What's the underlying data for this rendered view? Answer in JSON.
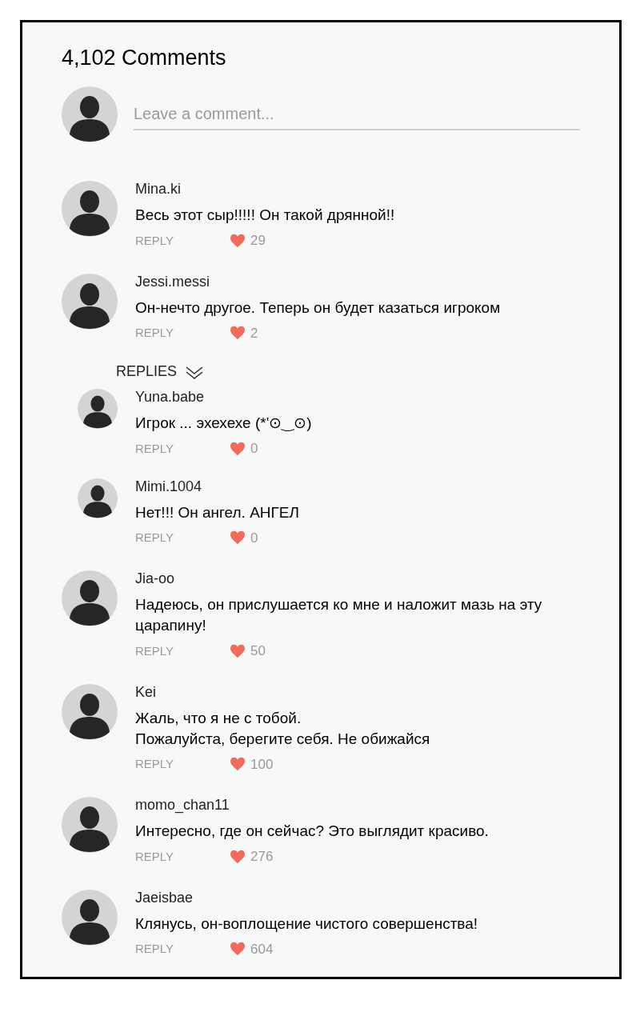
{
  "title": "4,102 Comments",
  "comment_field": {
    "placeholder": "Leave a comment..."
  },
  "comments": [
    {
      "user": "Mina.ki",
      "text": "Весь этот сыр!!!!! Он такой дрянной!!",
      "reply_label": "REPLY",
      "likes": "29"
    },
    {
      "user": "Jessi.messi",
      "text": "Он-нечто другое. Теперь он будет казаться игроком",
      "reply_label": "REPLY",
      "likes": "2",
      "replies": {
        "label": "REPLIES",
        "expanded": true,
        "items": [
          {
            "user": "Yuna.babe",
            "text": "Игрок ... эхехехе  (*'⊙‿⊙)",
            "reply_label": "REPLY",
            "likes": "0"
          },
          {
            "user": "Mimi.1004",
            "text": "Нет!!! Он ангел. АНГЕЛ",
            "reply_label": "REPLY",
            "likes": "0"
          }
        ]
      }
    },
    {
      "user": "Jia-oo",
      "text": "Надеюсь, он прислушается ко мне и наложит мазь на эту царапину!",
      "reply_label": "REPLY",
      "likes": "50"
    },
    {
      "user": "Kei",
      "text": "Жаль, что я не с тобой.\nПожалуйста, берегите себя. Не обижайся",
      "reply_label": "REPLY",
      "likes": "100"
    },
    {
      "user": "momo_chan11",
      "text": "Интересно, где он сейчас? Это выглядит красиво.",
      "reply_label": "REPLY",
      "likes": "276"
    },
    {
      "user": "Jaeisbae",
      "text": "Клянусь, он-воплощение чистого совершенства!",
      "reply_label": "REPLY",
      "likes": "604"
    }
  ]
}
